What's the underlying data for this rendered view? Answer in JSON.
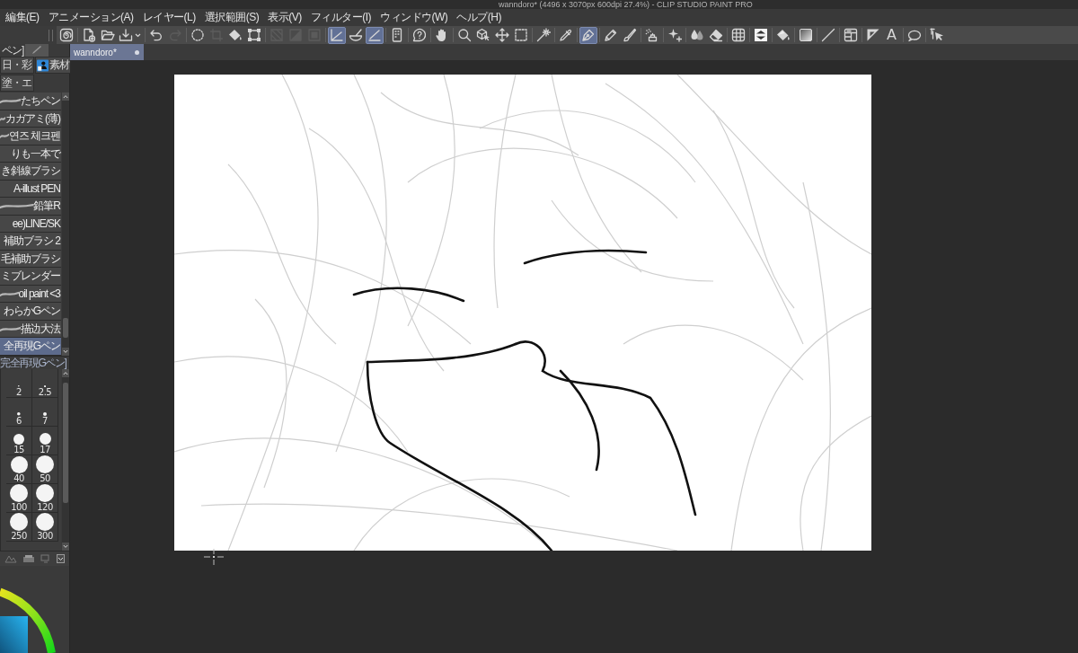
{
  "window": {
    "title": "wanndoro* (4496 x 3070px 600dpi 27.4%) - CLIP STUDIO PAINT PRO"
  },
  "menu_bar": [
    "編集(E)",
    "アニメーション(A)",
    "レイヤー(L)",
    "選択範囲(S)",
    "表示(V)",
    "フィルター(I)",
    "ウィンドウ(W)",
    "ヘルプ(H)"
  ],
  "toolbar": [
    {
      "buttons": [
        {
          "kind": "logo",
          "selected": false,
          "disabled": false
        }
      ]
    },
    {
      "buttons": [
        {
          "kind": "new",
          "selected": false,
          "disabled": false
        },
        {
          "kind": "open",
          "selected": false,
          "disabled": false
        },
        {
          "kind": "export",
          "selected": false,
          "disabled": false
        }
      ]
    },
    {
      "buttons": [
        {
          "kind": "undo",
          "selected": false,
          "disabled": false
        },
        {
          "kind": "redo",
          "selected": false,
          "disabled": true
        }
      ]
    },
    {
      "buttons": [
        {
          "kind": "deselect",
          "selected": false,
          "disabled": false
        },
        {
          "kind": "crop",
          "selected": false,
          "disabled": true
        },
        {
          "kind": "fill_selection",
          "selected": false,
          "disabled": false
        },
        {
          "kind": "transform",
          "selected": false,
          "disabled": false
        }
      ]
    },
    {
      "buttons": [
        {
          "kind": "slashed_square",
          "selected": false,
          "disabled": true
        },
        {
          "kind": "half_square",
          "selected": false,
          "disabled": true
        },
        {
          "kind": "inset_square",
          "selected": false,
          "disabled": true
        }
      ]
    },
    {
      "buttons": [
        {
          "kind": "corner_line",
          "selected": true,
          "disabled": false
        },
        {
          "kind": "bowl_brush",
          "selected": false,
          "disabled": false
        },
        {
          "kind": "angled_line",
          "selected": true,
          "disabled": false
        }
      ]
    },
    {
      "buttons": [
        {
          "kind": "tablet",
          "selected": false,
          "disabled": false
        }
      ]
    },
    {
      "buttons": [
        {
          "kind": "help",
          "selected": false,
          "disabled": false
        }
      ]
    },
    {
      "buttons": [
        {
          "kind": "hand",
          "selected": false,
          "disabled": false
        }
      ]
    },
    {
      "buttons": [
        {
          "kind": "zoom",
          "selected": false,
          "disabled": false
        },
        {
          "kind": "object",
          "selected": false,
          "disabled": false
        },
        {
          "kind": "move",
          "selected": false,
          "disabled": false
        },
        {
          "kind": "rect_select",
          "selected": false,
          "disabled": false
        }
      ]
    },
    {
      "buttons": [
        {
          "kind": "wand",
          "selected": false,
          "disabled": false
        }
      ]
    },
    {
      "buttons": [
        {
          "kind": "eyedropper",
          "selected": false,
          "disabled": false
        }
      ]
    },
    {
      "buttons": [
        {
          "kind": "pen",
          "selected": true,
          "disabled": false
        }
      ]
    },
    {
      "buttons": [
        {
          "kind": "pencil",
          "selected": false,
          "disabled": false
        },
        {
          "kind": "brush",
          "selected": false,
          "disabled": false
        }
      ]
    },
    {
      "buttons": [
        {
          "kind": "airbrush",
          "selected": false,
          "disabled": false
        }
      ]
    },
    {
      "buttons": [
        {
          "kind": "decoration",
          "selected": false,
          "disabled": false
        }
      ]
    },
    {
      "buttons": [
        {
          "kind": "blend",
          "selected": false,
          "disabled": false
        },
        {
          "kind": "eraser",
          "selected": false,
          "disabled": false
        }
      ]
    },
    {
      "buttons": [
        {
          "kind": "grid",
          "selected": false,
          "disabled": false
        }
      ]
    },
    {
      "buttons": [
        {
          "kind": "frame",
          "selected": false,
          "disabled": false
        }
      ]
    },
    {
      "buttons": [
        {
          "kind": "fill",
          "selected": false,
          "disabled": false
        }
      ]
    },
    {
      "buttons": [
        {
          "kind": "gradient",
          "selected": false,
          "disabled": false
        }
      ]
    },
    {
      "buttons": [
        {
          "kind": "line",
          "selected": false,
          "disabled": false
        }
      ]
    },
    {
      "buttons": [
        {
          "kind": "layout",
          "selected": false,
          "disabled": false
        }
      ]
    },
    {
      "buttons": [
        {
          "kind": "ruler",
          "selected": false,
          "disabled": false
        },
        {
          "kind": "text",
          "label": "A",
          "selected": false,
          "disabled": false
        }
      ]
    },
    {
      "buttons": [
        {
          "kind": "balloon",
          "selected": false,
          "disabled": false
        }
      ]
    },
    {
      "buttons": [
        {
          "kind": "pointer",
          "selected": false,
          "disabled": false
        }
      ]
    }
  ],
  "document_tabs": [
    {
      "label": "wanndoro*",
      "selected": true
    }
  ],
  "sub_tool_panel": {
    "tabs": [
      {
        "kind": "text",
        "label": "ペン]",
        "selected": true
      },
      {
        "kind": "pen",
        "selected": false
      }
    ],
    "group_buttons": [
      {
        "kind": "text",
        "label": "日・彩"
      },
      {
        "kind": "material",
        "label": "素材"
      },
      {
        "kind": "text",
        "label": "塗・エ"
      }
    ]
  },
  "sub_tools": [
    {
      "label": "たちペン",
      "preview": true,
      "selected": false
    },
    {
      "label": "カガアミ(薄)",
      "preview": true,
      "selected": false
    },
    {
      "label": "연즈 체크펜",
      "preview": true,
      "selected": false
    },
    {
      "label": "りも一本で",
      "preview": false,
      "selected": false
    },
    {
      "label": "き斜線ブラシ",
      "preview": false,
      "selected": false
    },
    {
      "label": "A-illust PEN",
      "preview": false,
      "selected": false
    },
    {
      "label": "鉛筆R",
      "preview": true,
      "selected": false
    },
    {
      "label": "ee)LINE/SK",
      "preview": false,
      "selected": false
    },
    {
      "label": "補助ブラシ 2",
      "preview": false,
      "selected": false
    },
    {
      "label": "毛補助ブラシ",
      "preview": false,
      "selected": false
    },
    {
      "label": "ミブレンダー",
      "preview": false,
      "selected": false
    },
    {
      "label": "oil paint <3",
      "preview": true,
      "selected": false
    },
    {
      "label": "わらかGペン",
      "preview": false,
      "selected": false
    },
    {
      "label": "描边大法",
      "preview": true,
      "selected": false
    },
    {
      "label": "全再現Gペン",
      "preview": false,
      "selected": true
    }
  ],
  "tool_property": {
    "title": "完全再現Gペン]",
    "sizes": [
      "2",
      "2.5",
      "6",
      "7",
      "15",
      "17",
      "40",
      "50",
      "100",
      "120",
      "250",
      "300"
    ]
  }
}
